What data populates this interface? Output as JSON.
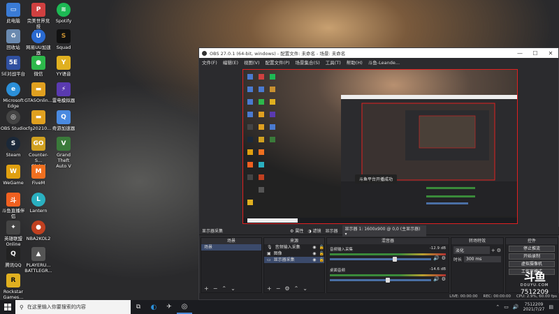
{
  "desktop": {
    "icons": [
      {
        "label": "此电脑",
        "color": "#3a7bd5"
      },
      {
        "label": "完美世界竞技\n平台",
        "color": "#d04040"
      },
      {
        "label": "Spotify",
        "color": "#1db954"
      },
      {
        "label": "回收站",
        "color": "#6a8ab0"
      },
      {
        "label": "网易UU加速器",
        "color": "#2a6ad0"
      },
      {
        "label": "Squad",
        "color": "#c89030"
      },
      {
        "label": "5E对战平台",
        "color": "#3050a0"
      },
      {
        "label": "微信",
        "color": "#2db84b"
      },
      {
        "label": "YY语音",
        "color": "#e0b020"
      },
      {
        "label": "Microsoft\nEdge",
        "color": "#2b8fd8"
      },
      {
        "label": "GTA5Onlin...",
        "color": "#e0a020"
      },
      {
        "label": "雷电模拟器",
        "color": "#5a3ab0"
      },
      {
        "label": "OBS Studio",
        "color": "#444"
      },
      {
        "label": "cfg20210...",
        "color": "#e0a020"
      },
      {
        "label": "奇游加速器",
        "color": "#4a8ae0"
      },
      {
        "label": "Steam",
        "color": "#1b2838"
      },
      {
        "label": "Counter-S...\nGlobal Off...",
        "color": "#d0a020"
      },
      {
        "label": "Grand Theft\nAuto V",
        "color": "#3a7a3a"
      },
      {
        "label": "WeGame",
        "color": "#e0a010"
      },
      {
        "label": "FiveM",
        "color": "#f07020"
      },
      {
        "label": "斗鱼直播伴侣",
        "color": "#f06020"
      },
      {
        "label": "Lantern",
        "color": "#2ab0c0"
      },
      {
        "label": "英雄联盟\nOnline",
        "color": "#444"
      },
      {
        "label": "NBA2KOL2",
        "color": "#c04020"
      },
      {
        "label": "腾讯QQ",
        "color": "#222"
      },
      {
        "label": "PLAYERU...\nBATTLEGR...",
        "color": "#555"
      },
      {
        "label": "Rockstar\nGames...",
        "color": "#e0b020"
      }
    ]
  },
  "taskbar": {
    "search_placeholder": "在这里输入你要搜索的内容",
    "time": "7512209",
    "date": "2021/7/27"
  },
  "obs": {
    "title": "OBS 27.0.1 (64-bit, windows) - 配置文件: 未命名 - 场景: 未命名",
    "menu": [
      "文件(F)",
      "编辑(E)",
      "视图(V)",
      "配置文件(P)",
      "场景集合(S)",
      "工具(T)",
      "帮助(H)",
      "斗鱼-Leande..."
    ],
    "sourcebar": {
      "current_source": "显示器采集",
      "properties": "属性",
      "filters": "滤镜",
      "display_label": "显示器",
      "display_value": "显示器 1: 1600x900 @ 0,0 (主显示器)"
    },
    "preview_toast": "斗鱼平台开播成功",
    "panels": {
      "scenes": {
        "header": "场景",
        "items": [
          "场景"
        ]
      },
      "sources": {
        "header": "来源",
        "items": [
          "音频输入采集",
          "图像",
          "显示器采集"
        ]
      },
      "mixer": {
        "header": "混音器",
        "channels": [
          {
            "name": "音频输入采集",
            "db": "-12.9 dB",
            "level": 0.62
          },
          {
            "name": "桌面音频",
            "db": "-14.6 dB",
            "level": 0.55
          }
        ]
      },
      "transitions": {
        "header": "转场特效",
        "type": "淡化",
        "duration_label": "时长",
        "duration": "300 ms"
      },
      "controls": {
        "header": "控件",
        "buttons": [
          "停止推流",
          "开始录制",
          "虚拟摄像机",
          "工作室模式"
        ]
      }
    },
    "status": {
      "live": "LIVE: 00:00:00",
      "rec": "REC: 00:00:00",
      "cpu": "CPU: 2.9%, 60.00 fps"
    }
  },
  "watermark": {
    "logo": "斗鱼",
    "sub": "DOUYU.COM",
    "room_id": "7512209"
  }
}
